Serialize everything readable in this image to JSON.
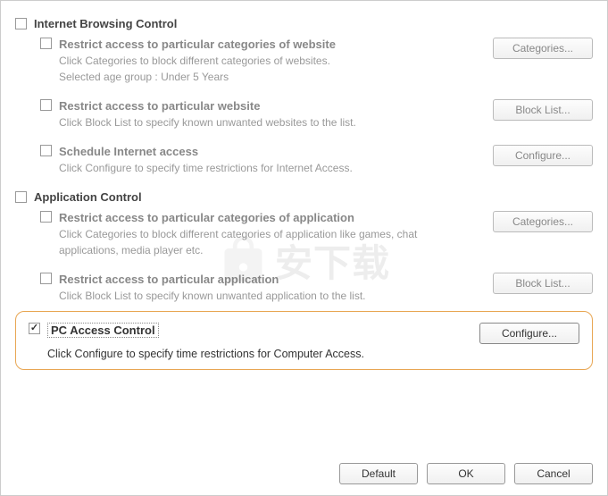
{
  "sections": {
    "internet": {
      "title": "Internet Browsing Control",
      "options": {
        "categories": {
          "title": "Restrict access to particular categories of website",
          "desc": "Click Categories to block different categories of websites.\nSelected age group : Under 5 Years",
          "button": "Categories..."
        },
        "website": {
          "title": "Restrict access to particular website",
          "desc": "Click Block List to specify known unwanted websites to the list.",
          "button": "Block List..."
        },
        "schedule": {
          "title": "Schedule Internet access",
          "desc": "Click Configure to specify time restrictions for Internet Access.",
          "button": "Configure..."
        }
      }
    },
    "application": {
      "title": "Application Control",
      "options": {
        "appcat": {
          "title": "Restrict access to particular categories of application",
          "desc": "Click Categories to block different categories of application like games, chat applications, media player etc.",
          "button": "Categories..."
        },
        "app": {
          "title": "Restrict access to particular application",
          "desc": "Click Block List to specify known unwanted application to the list.",
          "button": "Block List..."
        }
      }
    },
    "pc": {
      "title": "PC Access Control",
      "desc": "Click Configure to specify time restrictions for Computer Access.",
      "button": "Configure..."
    }
  },
  "footer": {
    "default": "Default",
    "ok": "OK",
    "cancel": "Cancel"
  },
  "watermark": "安下载"
}
